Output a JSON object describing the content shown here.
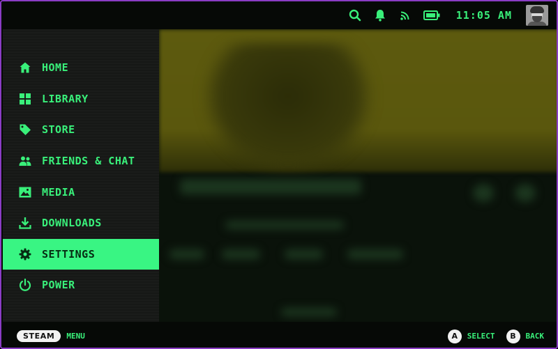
{
  "topbar": {
    "icons": [
      "search-icon",
      "bell-icon",
      "wifi-icon",
      "battery-icon"
    ],
    "time": "11:05 AM"
  },
  "sidebar": {
    "items": [
      {
        "label": "HOME",
        "icon": "home-icon"
      },
      {
        "label": "LIBRARY",
        "icon": "grid-icon"
      },
      {
        "label": "STORE",
        "icon": "tag-icon"
      },
      {
        "label": "FRIENDS & CHAT",
        "icon": "people-icon"
      },
      {
        "label": "MEDIA",
        "icon": "image-icon"
      },
      {
        "label": "DOWNLOADS",
        "icon": "download-icon"
      },
      {
        "label": "SETTINGS",
        "icon": "gear-icon",
        "active": true
      },
      {
        "label": "POWER",
        "icon": "power-icon"
      }
    ]
  },
  "bottombar": {
    "steam_label": "STEAM",
    "menu_label": "MENU",
    "a_button": "A",
    "select_label": "SELECT",
    "b_button": "B",
    "back_label": "BACK"
  },
  "colors": {
    "accent": "#39f07a",
    "active_bg": "#39f583",
    "frame_border": "#8a3cc4"
  }
}
